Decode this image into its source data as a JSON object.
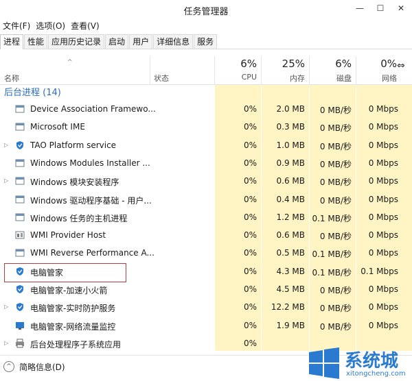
{
  "window": {
    "title": "任务管理器",
    "min_glyph": "—",
    "max_glyph": "☐",
    "close_glyph": "✕"
  },
  "menu": [
    "文件(F)",
    "选项(O)",
    "查看(V)"
  ],
  "tabs": [
    "进程",
    "性能",
    "应用历史记录",
    "启动",
    "用户",
    "详细信息",
    "服务"
  ],
  "active_tab": 0,
  "header": {
    "name_label": "名称",
    "status_label": "状态",
    "sort_arrow": "^",
    "resize_glyph": "⇔",
    "columns": [
      {
        "percent": "6%",
        "label": "CPU"
      },
      {
        "percent": "25%",
        "label": "内存"
      },
      {
        "percent": "6%",
        "label": "磁盘"
      },
      {
        "percent": "0%",
        "label": "网络"
      }
    ]
  },
  "group": {
    "title": "后台进程 (14)"
  },
  "rows": [
    {
      "name": "Device Association Framewo...",
      "expandable": false,
      "icon": "window-app-icon",
      "cpu": "0%",
      "mem": "2.0 MB",
      "disk": "0 MB/秒",
      "net": "0 Mbps"
    },
    {
      "name": "Microsoft IME",
      "expandable": false,
      "icon": "window-app-icon",
      "cpu": "0%",
      "mem": "0.3 MB",
      "disk": "0 MB/秒",
      "net": "0 Mbps"
    },
    {
      "name": "TAO Platform service",
      "expandable": true,
      "icon": "shield-icon",
      "cpu": "0%",
      "mem": "1.0 MB",
      "disk": "0 MB/秒",
      "net": "0 Mbps"
    },
    {
      "name": "Windows Modules Installer ...",
      "expandable": false,
      "icon": "window-app-icon",
      "cpu": "0%",
      "mem": "0.9 MB",
      "disk": "0 MB/秒",
      "net": "0 Mbps"
    },
    {
      "name": "Windows 模块安装程序",
      "expandable": true,
      "icon": "window-app-icon",
      "cpu": "0%",
      "mem": "0.6 MB",
      "disk": "0 MB/秒",
      "net": "0 Mbps"
    },
    {
      "name": "Windows 驱动程序基础 - 用户...",
      "expandable": false,
      "icon": "window-app-icon",
      "cpu": "0%",
      "mem": "0.4 MB",
      "disk": "0 MB/秒",
      "net": "0 Mbps"
    },
    {
      "name": "Windows 任务的主机进程",
      "expandable": false,
      "icon": "window-app-icon",
      "cpu": "0%",
      "mem": "1.2 MB",
      "disk": "0.1 MB/秒",
      "net": "0 Mbps"
    },
    {
      "name": "WMI Provider Host",
      "expandable": false,
      "icon": "wmi-icon",
      "cpu": "0%",
      "mem": "0.6 MB",
      "disk": "0 MB/秒",
      "net": "0 Mbps"
    },
    {
      "name": "WMI Reverse Performance A...",
      "expandable": false,
      "icon": "window-app-icon",
      "cpu": "0%",
      "mem": "0.5 MB",
      "disk": "0.1 MB/秒",
      "net": "0 Mbps"
    },
    {
      "name": "电脑管家",
      "expandable": false,
      "icon": "shield-icon",
      "cpu": "0%",
      "mem": "4.3 MB",
      "disk": "0.1 MB/秒",
      "net": "0.1 Mbps"
    },
    {
      "name": "电脑管家-加速小火箭",
      "expandable": false,
      "icon": "shield-icon",
      "cpu": "0%",
      "mem": "4.5 MB",
      "disk": "0 MB/秒",
      "net": "0 Mbps"
    },
    {
      "name": "电脑管家-实时防护服务",
      "expandable": true,
      "icon": "shield-icon",
      "cpu": "0%",
      "mem": "12.2 MB",
      "disk": "0 MB/秒",
      "net": "0 Mbps"
    },
    {
      "name": "电脑管家-网络流量监控",
      "expandable": false,
      "icon": "monitor-icon",
      "cpu": "0%",
      "mem": "1.9 MB",
      "disk": "0 MB/秒",
      "net": "0 Mbps"
    },
    {
      "name": "后台处理程序子系统应用",
      "expandable": true,
      "icon": "printer-icon",
      "cpu": "0%",
      "mem": "",
      "disk": "",
      "net": ""
    }
  ],
  "footer": {
    "fewer_details": "简略信息(D)",
    "chevron": "^"
  },
  "watermark": {
    "name": "系统城",
    "url": "xitongcheng.com"
  },
  "colors": {
    "accent": "#2a6ebb",
    "cell_highlight": "#fff4c4",
    "highlight_border": "#b04040"
  }
}
